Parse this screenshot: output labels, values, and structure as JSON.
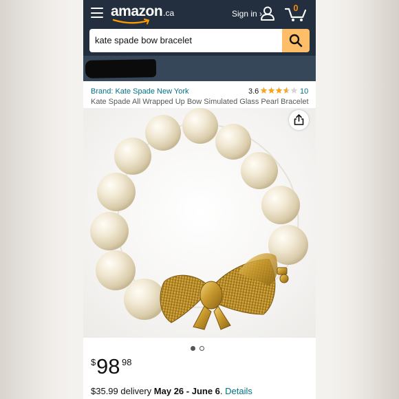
{
  "header": {
    "logo_text": "amazon",
    "logo_domain": ".ca",
    "signin_label": "Sign in ›",
    "cart_count": "0"
  },
  "search": {
    "query": "kate spade bow bracelet"
  },
  "product": {
    "brand": "Brand: Kate Spade New York",
    "rating_value": "3.6",
    "rating_stars": 3.6,
    "rating_count": "10",
    "title": "Kate Spade All Wrapped Up Bow Simulated Glass Pearl Bracelet",
    "image_dots": {
      "count": 2,
      "active_index": 0
    }
  },
  "price": {
    "symbol": "$",
    "whole": "98",
    "fraction": "98"
  },
  "delivery": {
    "prefix": "$35.99 delivery",
    "dates": "May 26 - June 6",
    "separator": ".",
    "details_label": "Details"
  },
  "colors": {
    "header_bg": "#232f3e",
    "location_bg": "#37475a",
    "search_button": "#febd69",
    "link": "#007185",
    "star": "#f5a623"
  }
}
